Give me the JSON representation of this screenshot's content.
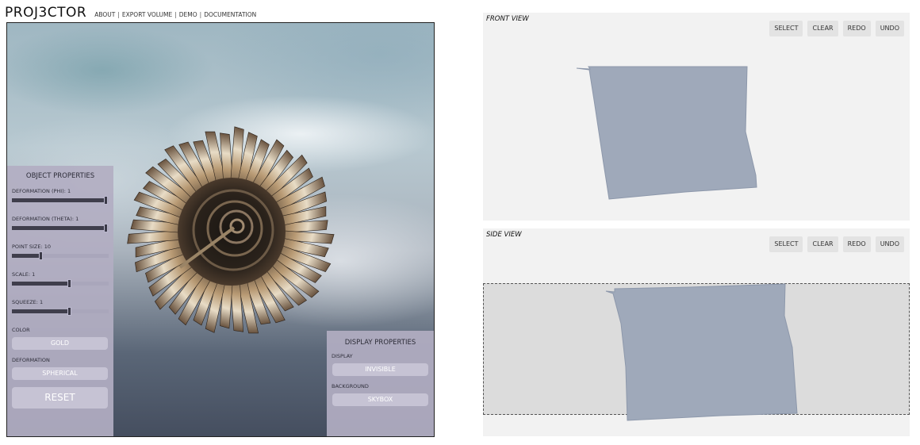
{
  "header": {
    "logo": "PROJ3CTOR",
    "nav": [
      "ABOUT",
      "EXPORT VOLUME",
      "DEMO",
      "DOCUMENTATION"
    ],
    "separator": "|"
  },
  "object_properties": {
    "title": "OBJECT PROPERTIES",
    "sliders": [
      {
        "label": "DEFORMATION (PHI): 1",
        "level": 1.0
      },
      {
        "label": "DEFORMATION (THETA): 1",
        "level": 1.0
      },
      {
        "label": "POINT SIZE: 10",
        "level": 0.29
      },
      {
        "label": "SCALE: 1",
        "level": 0.6
      },
      {
        "label": "SQUEEZE: 1",
        "level": 0.6
      }
    ],
    "color_label": "COLOR",
    "color_value": "GOLD",
    "deformation_label": "DEFORMATION",
    "deformation_value": "SPHERICAL",
    "reset_label": "RESET"
  },
  "display_properties": {
    "title": "DISPLAY PROPERTIES",
    "display_label": "DISPLAY",
    "display_value": "INVISIBLE",
    "background_label": "BACKGROUND",
    "background_value": "SKYBOX"
  },
  "front_view": {
    "title": "FRONT VIEW",
    "buttons": [
      "SELECT",
      "CLEAR",
      "REDO",
      "UNDO"
    ]
  },
  "side_view": {
    "title": "SIDE VIEW",
    "buttons": [
      "SELECT",
      "CLEAR",
      "REDO",
      "UNDO"
    ]
  },
  "colors": {
    "shape_fill": "#9fa9ba",
    "shape_stroke": "#8d98ab",
    "panel_bg": "#b2aec2",
    "button_bg": "#c6c3d4"
  }
}
